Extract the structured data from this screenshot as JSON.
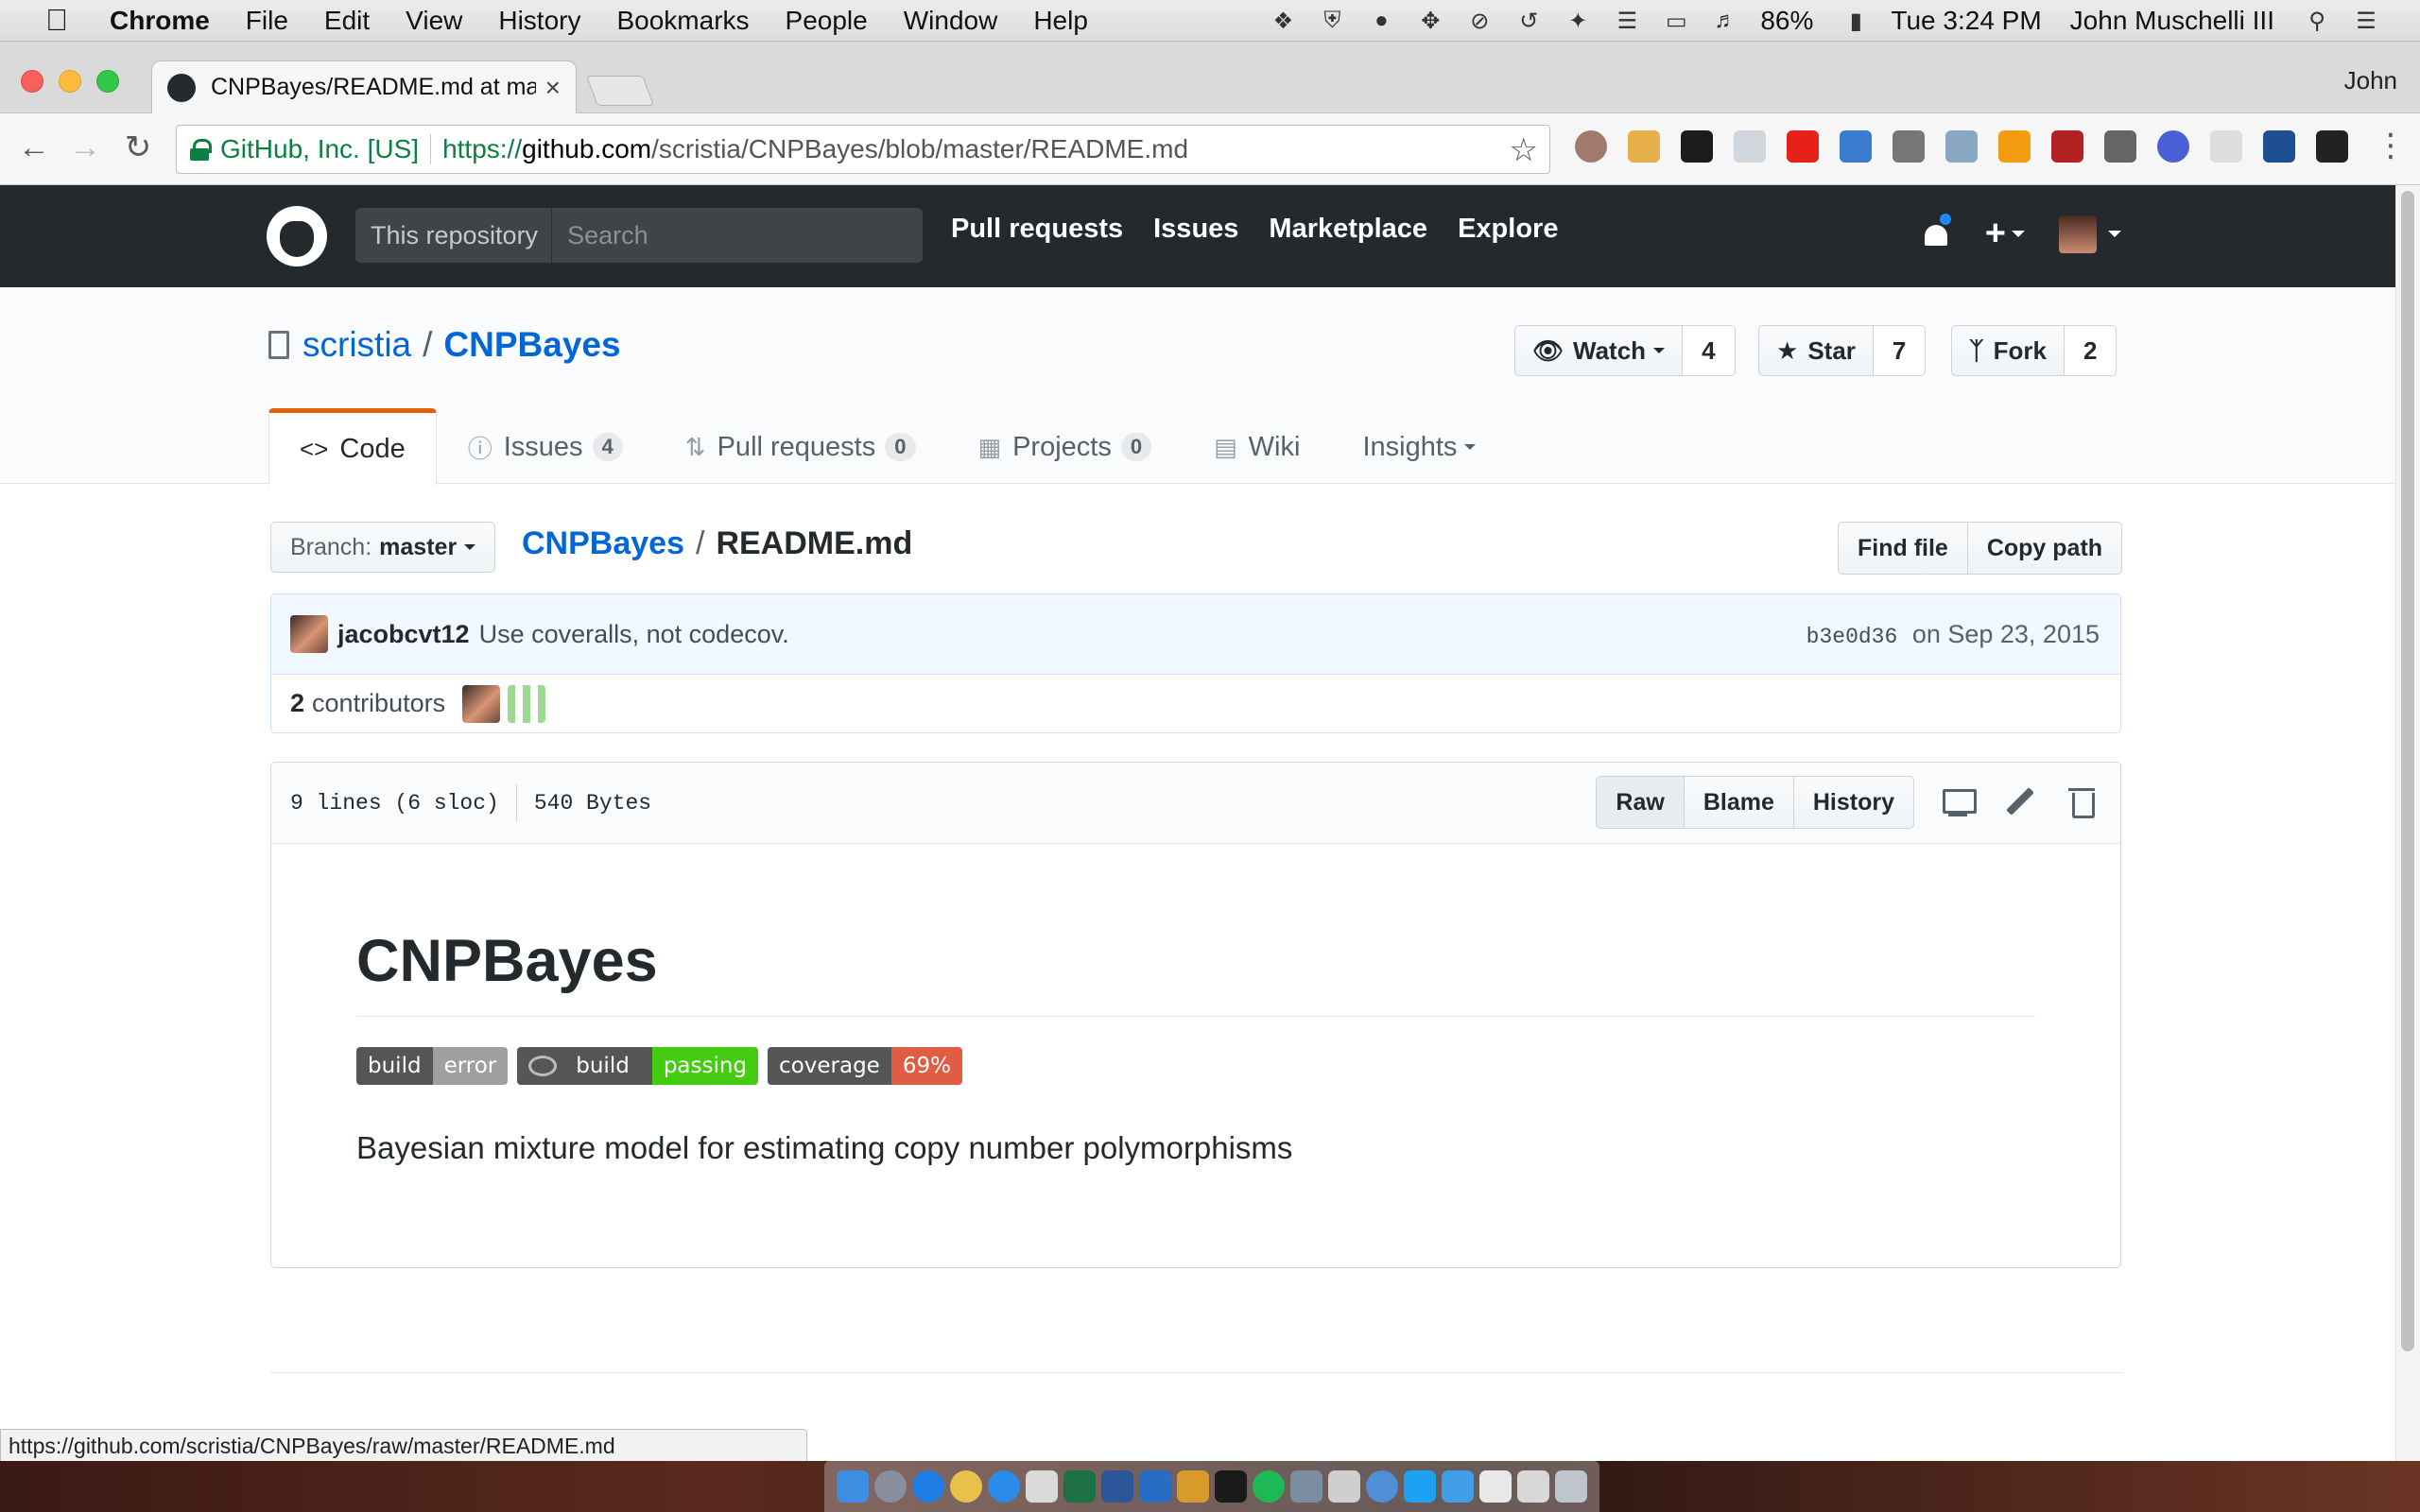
{
  "menubar": {
    "app": "Chrome",
    "items": [
      "File",
      "Edit",
      "View",
      "History",
      "Bookmarks",
      "People",
      "Window",
      "Help"
    ],
    "battery": "86%",
    "clock": "Tue 3:24 PM",
    "user": "John Muschelli III"
  },
  "browser": {
    "tab_title": "CNPBayes/README.md at mas",
    "profile": "John",
    "secure_label": "GitHub, Inc. [US]",
    "url_prefix": "https://",
    "url_host": "github.com",
    "url_path": "/scristia/CNPBayes/blob/master/README.md",
    "status_url": "https://github.com/scristia/CNPBayes/raw/master/README.md",
    "icons": {
      "back": "back-arrow-icon",
      "forward": "forward-arrow-icon",
      "reload": "reload-icon",
      "star": "bookmark-star-icon",
      "menu": "chrome-menu-icon"
    }
  },
  "github": {
    "scope_label": "This repository",
    "search_placeholder": "Search",
    "nav": [
      "Pull requests",
      "Issues",
      "Marketplace",
      "Explore"
    ],
    "brand_color": "#24292e"
  },
  "repo": {
    "owner": "scristia",
    "separator": "/",
    "name": "CNPBayes",
    "watch_label": "Watch",
    "watch_count": "4",
    "star_label": "Star",
    "star_count": "7",
    "fork_label": "Fork",
    "fork_count": "2",
    "tabs": {
      "code": "Code",
      "issues": "Issues",
      "issues_count": "4",
      "pulls": "Pull requests",
      "pulls_count": "0",
      "projects": "Projects",
      "projects_count": "0",
      "wiki": "Wiki",
      "insights": "Insights"
    }
  },
  "file_nav": {
    "branch_label": "Branch:",
    "branch": "master",
    "crumb_repo": "CNPBayes",
    "crumb_sep": "/",
    "crumb_file": "README.md",
    "find_file": "Find file",
    "copy_path": "Copy path"
  },
  "commit": {
    "author": "jacobcvt12",
    "message": "Use coveralls, not codecov.",
    "sha": "b3e0d36",
    "date": "on Sep 23, 2015",
    "contributors_count": "2",
    "contributors_label": "contributors"
  },
  "file": {
    "lines": "9 lines (6 sloc)",
    "size": "540 Bytes",
    "raw": "Raw",
    "blame": "Blame",
    "history": "History"
  },
  "readme": {
    "title": "CNPBayes",
    "badges": [
      {
        "label": "build",
        "value": "error",
        "color": "#9f9f9f"
      },
      {
        "label": "build",
        "value": "passing",
        "color": "#44cc11"
      },
      {
        "label": "coverage",
        "value": "69%",
        "color": "#e05d44"
      }
    ],
    "description": "Bayesian mixture model for estimating copy number polymorphisms"
  }
}
